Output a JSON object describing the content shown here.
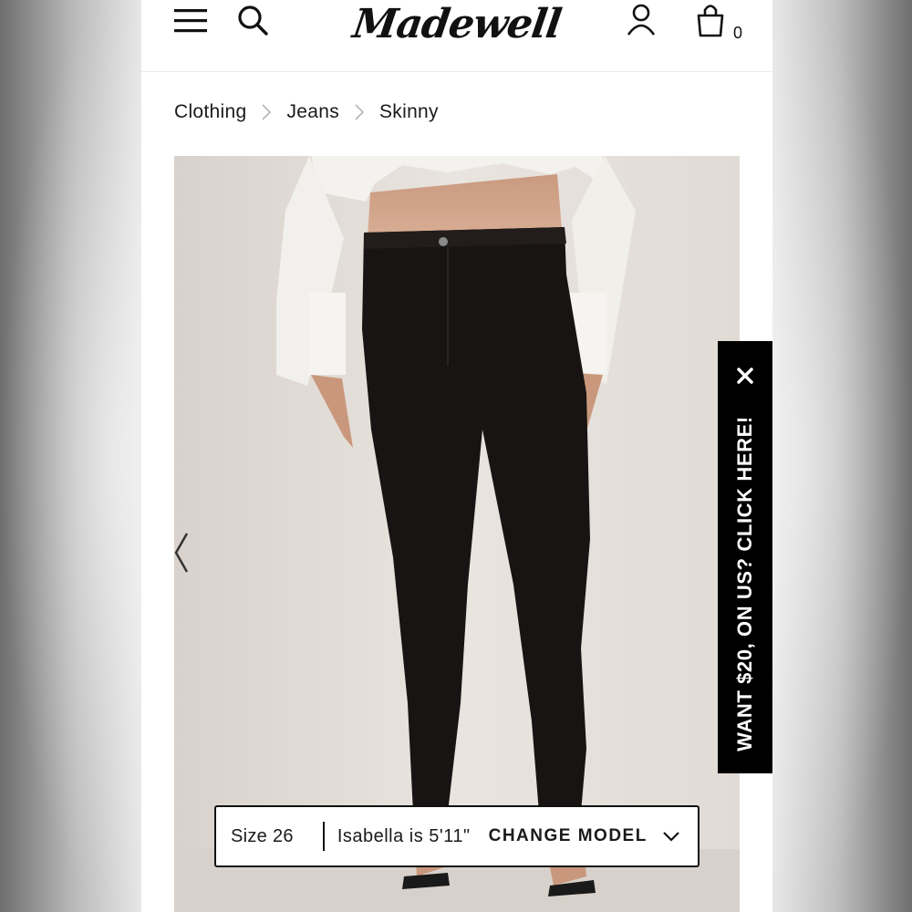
{
  "header": {
    "menu_icon": "hamburger-menu-icon",
    "search_icon": "search-icon",
    "logo_text": "Madewell",
    "account_icon": "user-icon",
    "bag_icon": "shopping-bag-icon",
    "bag_count": "0"
  },
  "breadcrumb": {
    "items": [
      {
        "label": "Clothing"
      },
      {
        "label": "Jeans"
      },
      {
        "label": "Skinny"
      }
    ],
    "separator_icon": "chevron-right-icon"
  },
  "gallery": {
    "prev_icon": "chevron-left-icon"
  },
  "model_bar": {
    "size_label": "Size 26",
    "model_desc": "Isabella is 5'11\"",
    "change_label": "CHANGE MODEL",
    "dropdown_icon": "chevron-down-icon"
  },
  "promo": {
    "text": "WANT $20, ON US? CLICK HERE!",
    "close_icon": "close-icon",
    "background": "#000000",
    "text_color": "#ffffff"
  }
}
